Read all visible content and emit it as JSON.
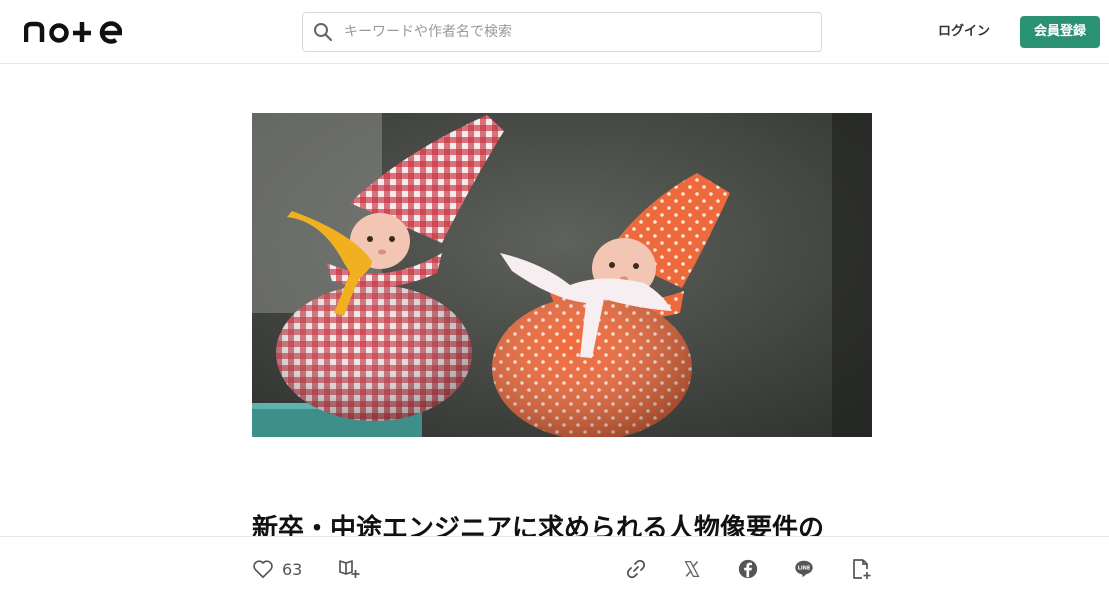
{
  "header": {
    "logo_text": "note",
    "search_placeholder": "キーワードや作者名で検索",
    "login_label": "ログイン",
    "signup_label": "会員登録",
    "signup_color": "#2a9173"
  },
  "article": {
    "title": "新卒・中途エンジニアに求められる人物像要件の",
    "hero_image": "two-fabric-sachet-dolls"
  },
  "action_bar": {
    "like_count": "63",
    "icons": [
      "heart-icon",
      "magazine-add-icon",
      "link-icon",
      "x-icon",
      "facebook-icon",
      "line-icon",
      "note-add-icon"
    ]
  }
}
